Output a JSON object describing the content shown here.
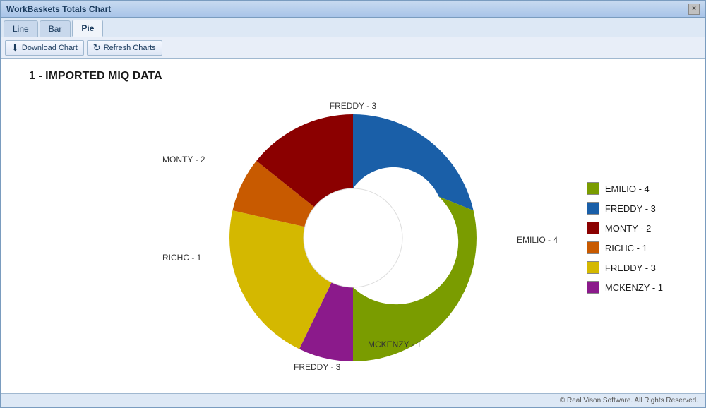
{
  "window": {
    "title": "WorkBaskets Totals Chart",
    "close_label": "×"
  },
  "tabs": [
    {
      "label": "Line",
      "active": false
    },
    {
      "label": "Bar",
      "active": false
    },
    {
      "label": "Pie",
      "active": true
    }
  ],
  "toolbar": {
    "download_label": "Download Chart",
    "refresh_label": "Refresh Charts"
  },
  "chart": {
    "title": "1 - IMPORTED MIQ DATA",
    "segments": [
      {
        "label": "EMILIO - 4",
        "value": 4,
        "color": "#7a9c00",
        "start_angle": 0,
        "sweep": 98
      },
      {
        "label": "FREDDY - 3",
        "value": 3,
        "color": "#1a5fa8",
        "start_angle": 98,
        "sweep": 73
      },
      {
        "label": "MONTY - 2",
        "value": 2,
        "color": "#8b0000",
        "start_angle": 171,
        "sweep": 49
      },
      {
        "label": "RICHC - 1",
        "value": 1,
        "color": "#c85a00",
        "start_angle": 220,
        "sweep": 24
      },
      {
        "label": "FREDDY - 3",
        "value": 3,
        "color": "#d4b800",
        "start_angle": 244,
        "sweep": 73
      },
      {
        "label": "MCKENZY - 1",
        "value": 1,
        "color": "#8b1a8b",
        "start_angle": 317,
        "sweep": 24
      }
    ],
    "labels": {
      "freddy_top": "FREDDY - 3",
      "emilio": "EMILIO - 4",
      "mckenzy": "MCKENZY - 1",
      "freddy_bottom": "FREDDY - 3",
      "richc": "RICHC - 1",
      "monty": "MONTY - 2"
    }
  },
  "legend": [
    {
      "label": "EMILIO - 4",
      "color": "#7a9c00"
    },
    {
      "label": "FREDDY - 3",
      "color": "#1a5fa8"
    },
    {
      "label": "MONTY - 2",
      "color": "#8b0000"
    },
    {
      "label": "RICHC - 1",
      "color": "#c85a00"
    },
    {
      "label": "FREDDY - 3",
      "color": "#d4b800"
    },
    {
      "label": "MCKENZY - 1",
      "color": "#8b1a8b"
    }
  ],
  "status_bar": {
    "text": "© Real Vison Software. All Rights Reserved."
  }
}
